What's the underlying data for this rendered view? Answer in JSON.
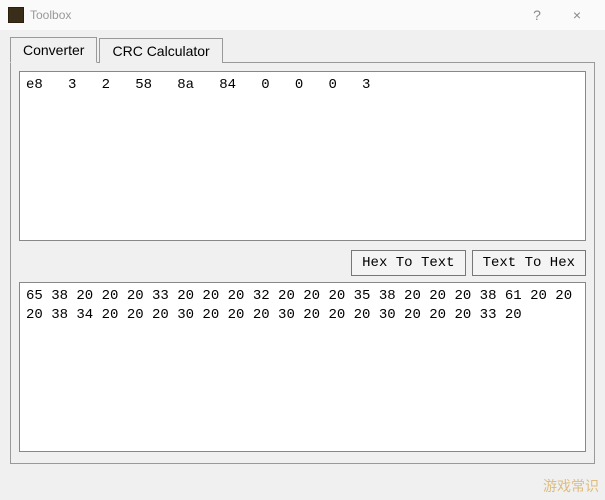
{
  "window": {
    "title": "Toolbox",
    "help_label": "?",
    "close_label": "×"
  },
  "tabs": {
    "converter": "Converter",
    "crc": "CRC Calculator"
  },
  "converter": {
    "input_text": "e8   3   2   58   8a   84   0   0   0   3",
    "output_text": "65 38 20 20 20 33 20 20 20 32 20 20 20 35 38 20 20 20 38 61 20 20 20 38 34 20 20 20 30 20 20 20 30 20 20 20 30 20 20 20 33 20",
    "hex_to_text_label": "Hex To Text",
    "text_to_hex_label": "Text To Hex"
  },
  "watermark": "游戏常识"
}
